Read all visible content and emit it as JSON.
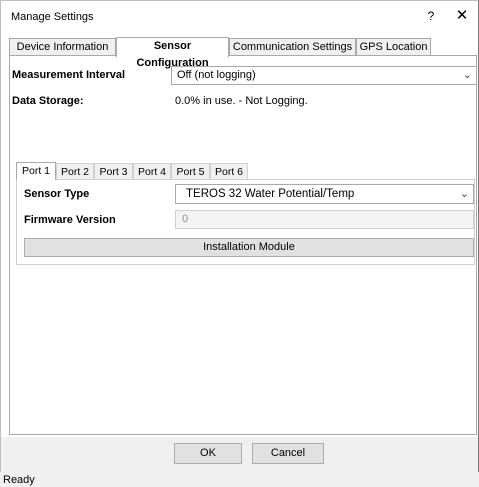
{
  "window": {
    "title": "Manage Settings",
    "help_glyph": "?",
    "close_glyph": "✕"
  },
  "tabs": [
    {
      "label": "Device Information",
      "active": false
    },
    {
      "label": "Sensor Configuration",
      "active": true
    },
    {
      "label": "Communication Settings",
      "active": false
    },
    {
      "label": "GPS Location",
      "active": false
    }
  ],
  "measurement_interval": {
    "label": "Measurement Interval",
    "value": "Off (not logging)"
  },
  "data_storage": {
    "label": "Data Storage:",
    "value": "0.0% in use.  -  Not Logging."
  },
  "ports": [
    {
      "label": "Port 1",
      "active": true
    },
    {
      "label": "Port 2",
      "active": false
    },
    {
      "label": "Port 3",
      "active": false
    },
    {
      "label": "Port 4",
      "active": false
    },
    {
      "label": "Port 5",
      "active": false
    },
    {
      "label": "Port 6",
      "active": false
    }
  ],
  "sensor_type": {
    "label": "Sensor Type",
    "value": "TEROS 32 Water Potential/Temp"
  },
  "firmware_version": {
    "label": "Firmware Version",
    "value": "0"
  },
  "installation_module_label": "Installation Module",
  "buttons": {
    "ok": "OK",
    "cancel": "Cancel"
  },
  "status": "Ready",
  "icons": {
    "dropdown": "chevron-down-icon"
  }
}
